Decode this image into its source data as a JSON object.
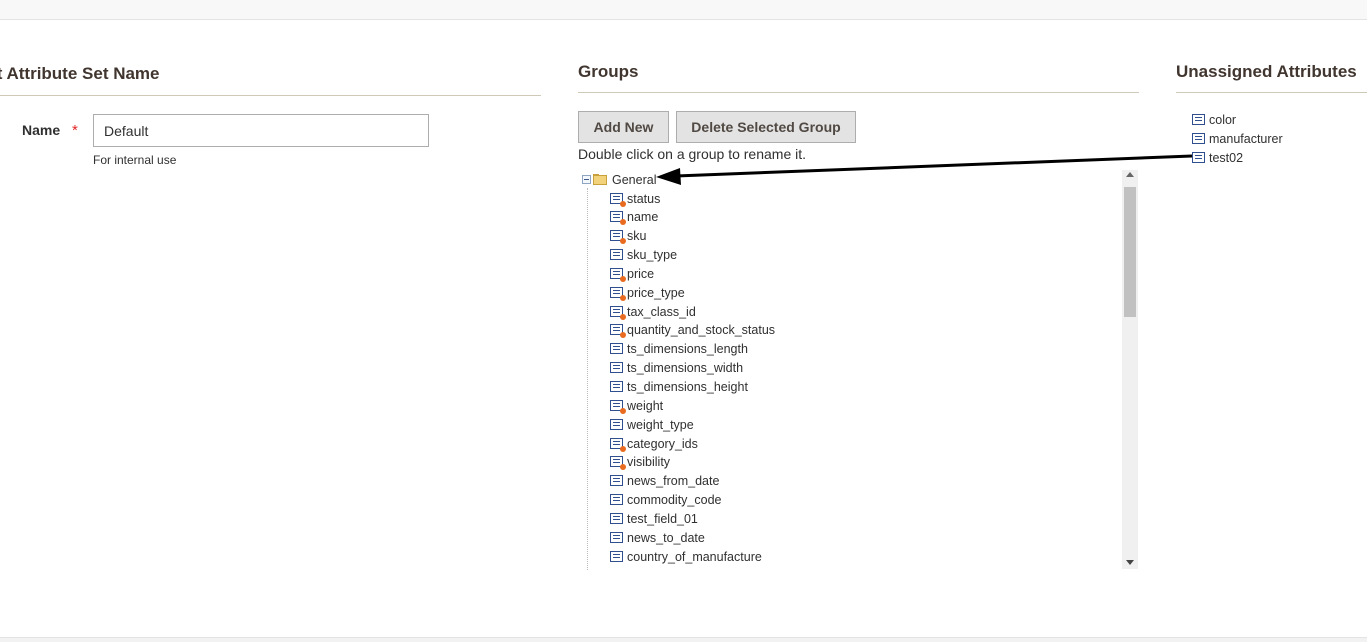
{
  "edit_section": {
    "title": "it Attribute Set Name",
    "name_label": "Name",
    "required_star": "*",
    "name_value": "Default",
    "name_note": "For internal use"
  },
  "groups_section": {
    "title": "Groups",
    "add_new_label": "Add New",
    "delete_group_label": "Delete Selected Group",
    "hint": "Double click on a group to rename it.",
    "tree": {
      "group_name": "General",
      "items": [
        {
          "label": "status",
          "system": true
        },
        {
          "label": "name",
          "system": true
        },
        {
          "label": "sku",
          "system": true
        },
        {
          "label": "sku_type",
          "system": false
        },
        {
          "label": "price",
          "system": true
        },
        {
          "label": "price_type",
          "system": true
        },
        {
          "label": "tax_class_id",
          "system": true
        },
        {
          "label": "quantity_and_stock_status",
          "system": true
        },
        {
          "label": "ts_dimensions_length",
          "system": false
        },
        {
          "label": "ts_dimensions_width",
          "system": false
        },
        {
          "label": "ts_dimensions_height",
          "system": false
        },
        {
          "label": "weight",
          "system": true
        },
        {
          "label": "weight_type",
          "system": false
        },
        {
          "label": "category_ids",
          "system": true
        },
        {
          "label": "visibility",
          "system": true
        },
        {
          "label": "news_from_date",
          "system": false
        },
        {
          "label": "commodity_code",
          "system": false
        },
        {
          "label": "test_field_01",
          "system": false
        },
        {
          "label": "news_to_date",
          "system": false
        },
        {
          "label": "country_of_manufacture",
          "system": false
        }
      ]
    }
  },
  "unassigned_section": {
    "title": "Unassigned Attributes",
    "items": [
      "color",
      "manufacturer",
      "test02"
    ]
  },
  "annotation": {
    "arrow_color": "#000000"
  }
}
